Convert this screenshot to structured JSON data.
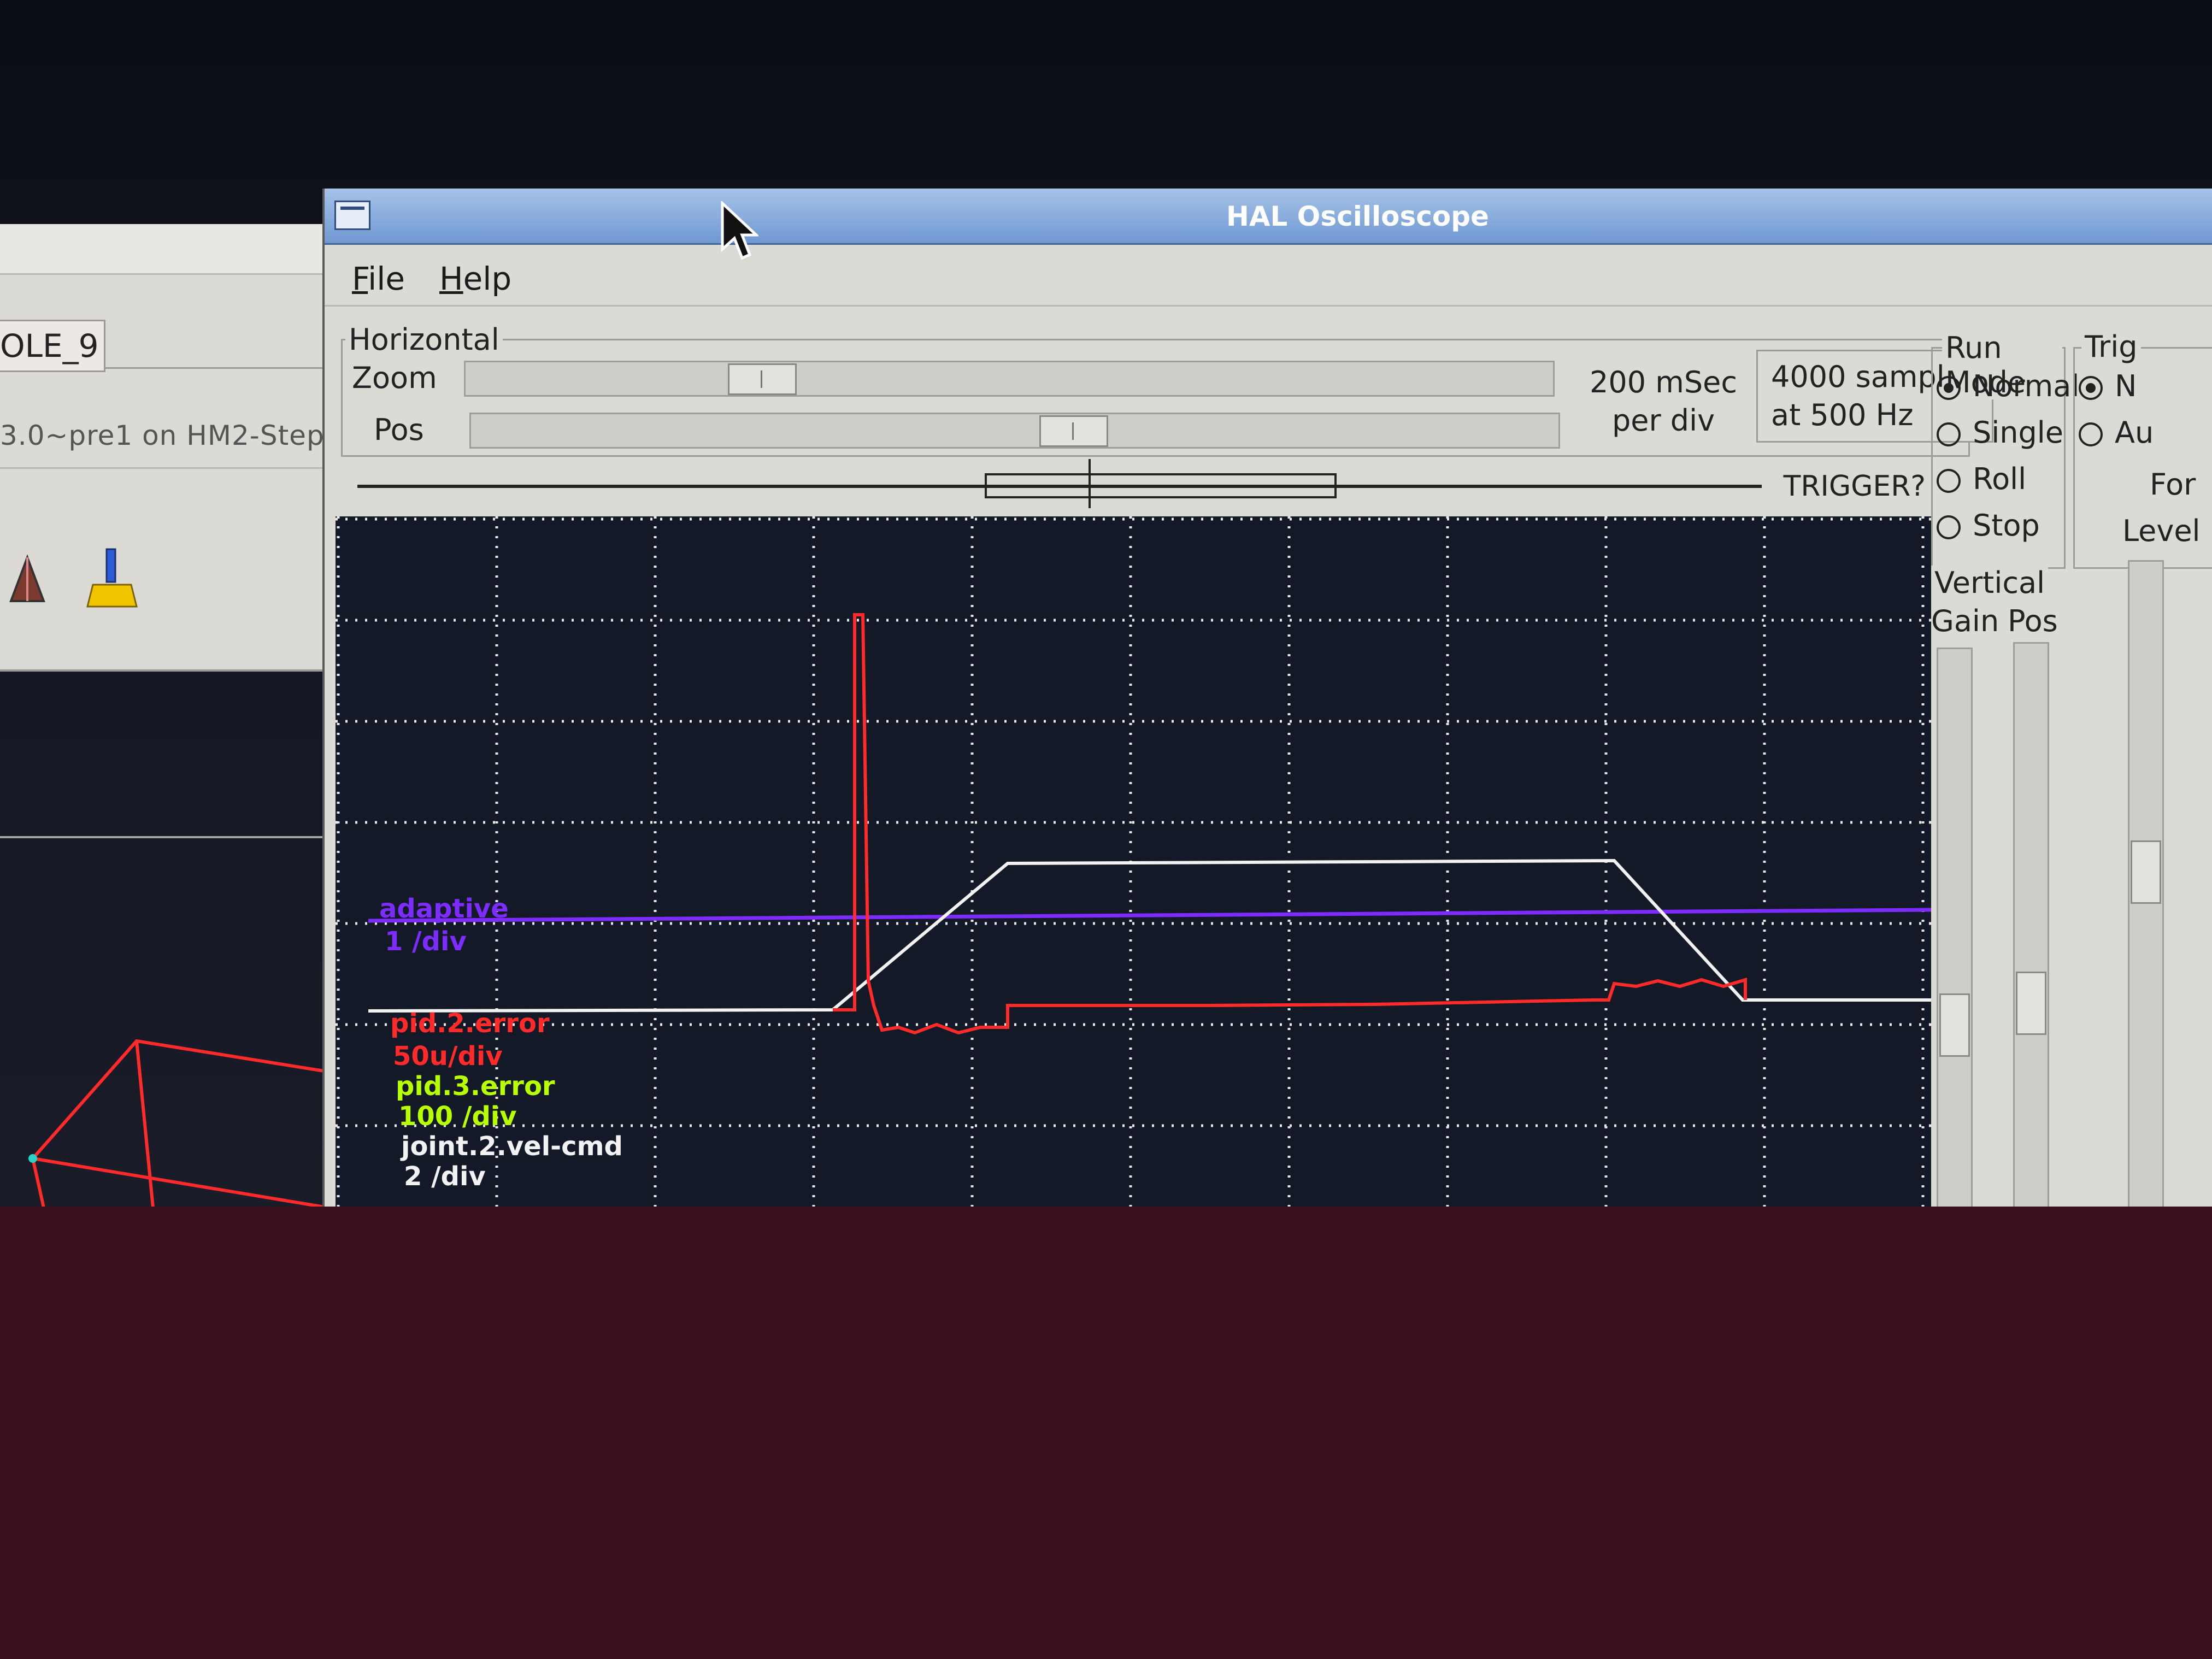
{
  "background_app": {
    "tab_label": "OLE_9",
    "info_text": "3.0~pre1 on HM2-Steppe"
  },
  "window": {
    "title": "HAL Oscilloscope"
  },
  "menu": {
    "file": "File",
    "help": "Help"
  },
  "horizontal": {
    "group_label": "Horizontal",
    "zoom_label": "Zoom",
    "pos_label": "Pos",
    "timebase_line1": "200 mSec",
    "timebase_line2": "per div",
    "samples_line1": "4000 samples",
    "samples_line2": "at 500 Hz",
    "trigger_label": "TRIGGER?"
  },
  "run_mode": {
    "group_label": "Run Mode",
    "options": [
      "Normal",
      "Single",
      "Roll",
      "Stop"
    ],
    "selected": "Normal"
  },
  "trigger_panel": {
    "group_label": "Trig",
    "option1": "N",
    "option2": "Au",
    "force_button": "For",
    "level_label": "Level"
  },
  "vertical": {
    "group_label": "Vertical",
    "gain_label": "Gain",
    "pos_label": "Pos"
  },
  "traces": [
    {
      "name": "adaptive",
      "scale": "1 /div",
      "color": "#7d2cff"
    },
    {
      "name": "pid.2.error",
      "scale": "50u/div",
      "color": "#ff2a2a"
    },
    {
      "name": "pid.3.error",
      "scale": "100 /div",
      "color": "#b8ff00"
    },
    {
      "name": "joint.2.vel-cmd",
      "scale": "2 /div",
      "color": "#f2f2f2"
    }
  ]
}
